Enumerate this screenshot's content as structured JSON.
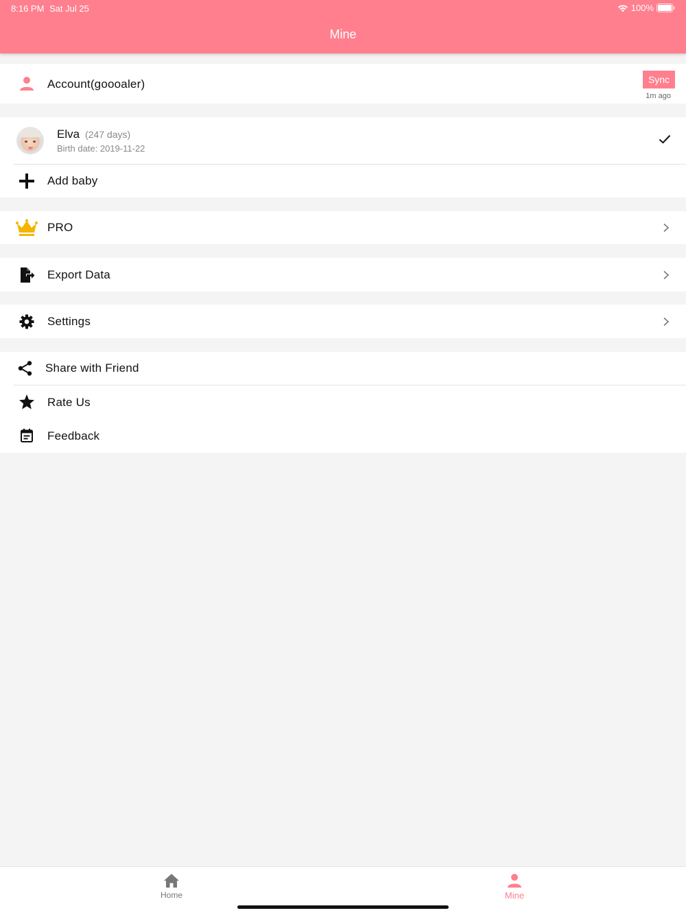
{
  "status_bar": {
    "time": "8:16 PM",
    "date": "Sat Jul 25",
    "battery": "100%"
  },
  "header": {
    "title": "Mine"
  },
  "account": {
    "label": "Account(goooaler)",
    "sync_label": "Sync",
    "sync_time": "1m ago"
  },
  "baby": {
    "name": "Elva",
    "days": "(247 days)",
    "birth": "Birth date: 2019-11-22"
  },
  "add_baby": {
    "label": "Add baby"
  },
  "pro": {
    "label": "PRO"
  },
  "export": {
    "label": "Export Data"
  },
  "settings": {
    "label": "Settings"
  },
  "share": {
    "label": "Share with Friend"
  },
  "rate": {
    "label": "Rate Us"
  },
  "feedback": {
    "label": "Feedback"
  },
  "tabs": [
    {
      "label": "Home",
      "icon": "home-icon"
    },
    {
      "label": "Mine",
      "icon": "person-icon"
    }
  ],
  "colors": {
    "accent": "#ff7f8e",
    "crown": "#f5b400",
    "background": "#f4f4f4"
  }
}
